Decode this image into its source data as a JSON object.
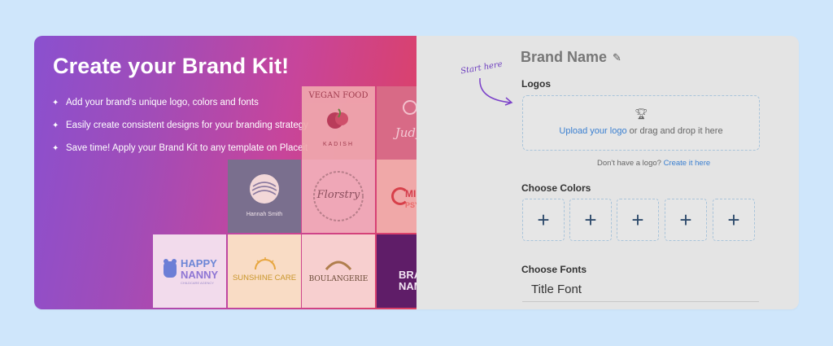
{
  "left": {
    "title": "Create your Brand Kit!",
    "features": [
      "Add your brand's unique logo, colors and fonts",
      "Easily create consistent designs for your branding strategy",
      "Save time! Apply your Brand Kit to any template on Placeit"
    ],
    "logos": {
      "vegan_1": "VEGAN FOOD",
      "vegan_2": "KADISH",
      "judy": "Judy J",
      "hannah": "Hannah Smith",
      "floristry": "Florstry",
      "mind_1": "MIN",
      "mind_2": "PSYCH",
      "happy_1": "HAPPY",
      "happy_2": "NANNY",
      "happy_3": "CHILDCARE AGENCY",
      "sunshine": "SUNSHINE CARE",
      "boulangerie": "BOULANGERIE",
      "brand_1": "BRA",
      "brand_2": "NAM"
    }
  },
  "right": {
    "brand_name": "Brand Name",
    "start_here": "Start here",
    "logos_label": "Logos",
    "upload_link": "Upload your logo",
    "upload_rest": " or drag and drop it here",
    "no_logo_text": "Don't have a logo? ",
    "create_link": "Create it here",
    "colors_label": "Choose Colors",
    "color_plus": [
      "+",
      "+",
      "+",
      "+",
      "+"
    ],
    "fonts_label": "Choose Fonts",
    "title_font": "Title Font"
  },
  "icons": {
    "feature_bullet": "sparkle-icon",
    "edit": "pencil-icon",
    "upload": "trophy-icon",
    "arrow": "curved-arrow-icon"
  }
}
